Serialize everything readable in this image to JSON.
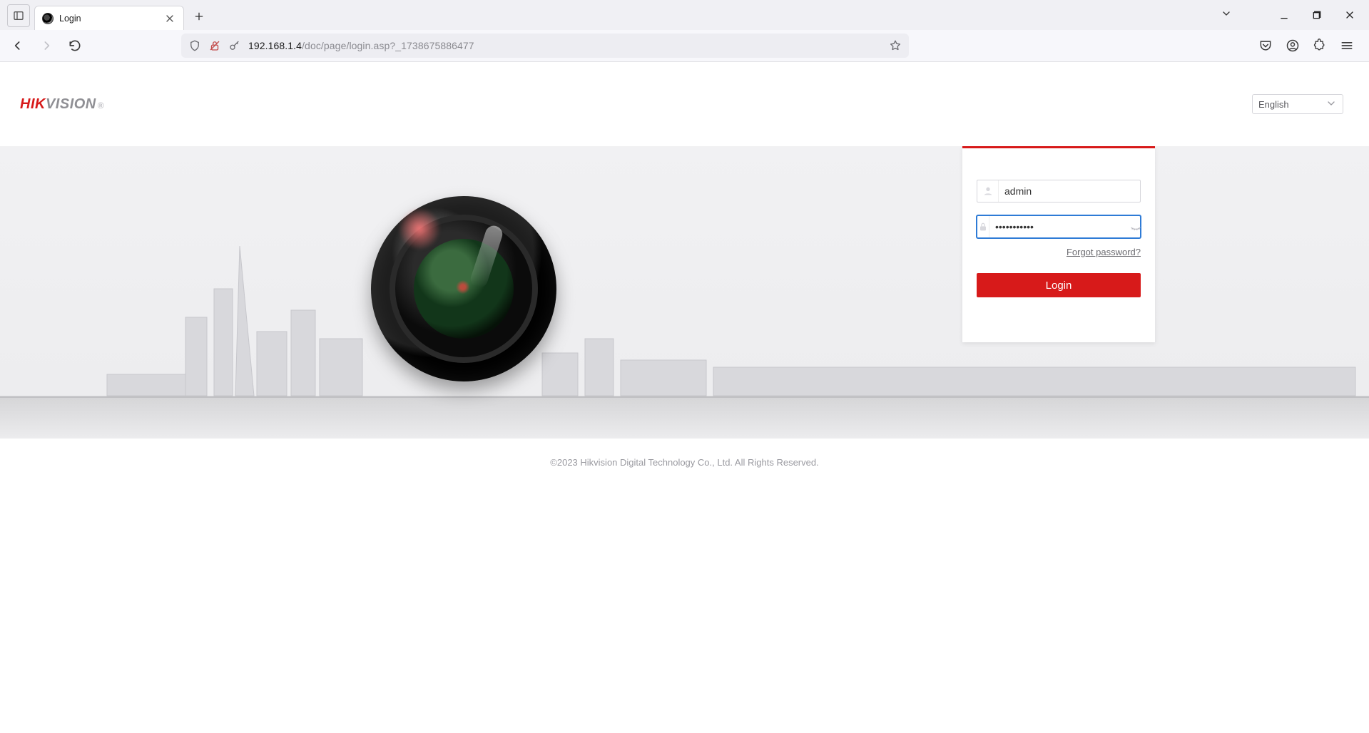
{
  "browser": {
    "tab_title": "Login",
    "url_host": "192.168.1.4",
    "url_path": "/doc/page/login.asp?_1738675886477"
  },
  "brand": {
    "hik": "HIK",
    "vision": "VISION",
    "reg": "®"
  },
  "language": {
    "selected": "English"
  },
  "login": {
    "username_value": "admin",
    "password_value": "•••••••••••",
    "forgot_label": "Forgot password?",
    "button_label": "Login"
  },
  "footer": {
    "copyright": "©2023 Hikvision Digital Technology Co., Ltd. All Rights Reserved."
  },
  "colors": {
    "accent": "#d71a1a",
    "focus": "#2e7bd6"
  }
}
